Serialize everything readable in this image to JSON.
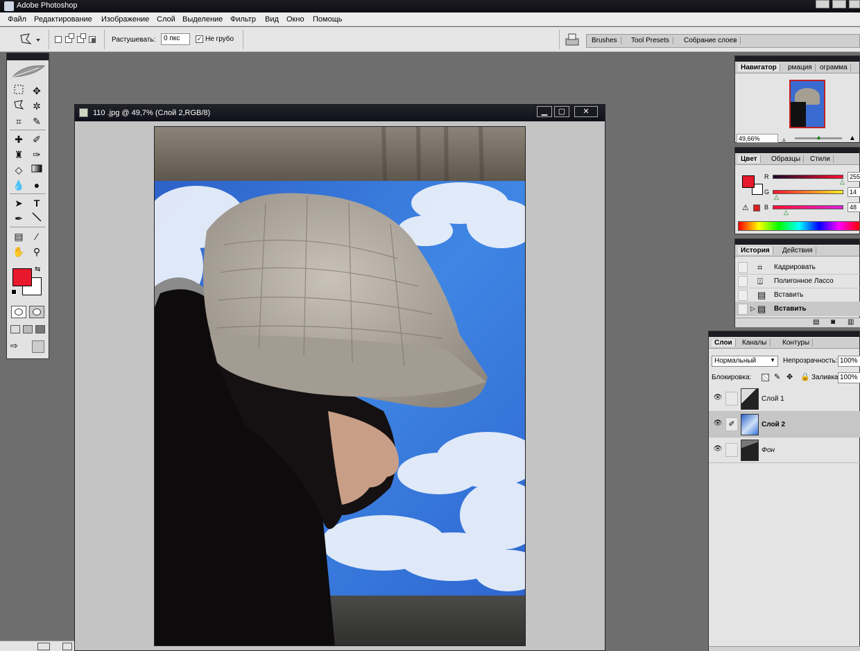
{
  "app": {
    "title": "Adobe Photoshop"
  },
  "menu": [
    "Файл",
    "Редактирование",
    "Изображение",
    "Слой",
    "Выделение",
    "Фильтр",
    "Вид",
    "Окно",
    "Помощь"
  ],
  "options": {
    "feather_label": "Растушевать:",
    "feather_value": "0 пкс",
    "antialias_label": "Не грубо",
    "antialias_check": "✓"
  },
  "palette_well": {
    "tabs": [
      "Brushes",
      "Tool Presets",
      "Собрание слоев"
    ]
  },
  "document": {
    "title": "110 .jpg @ 49,7% (Слой 2,RGB/8)"
  },
  "navigator": {
    "tabs": [
      "Навигатор",
      "рмация",
      "ограмма"
    ],
    "zoom": "49,66%"
  },
  "color": {
    "tabs": [
      "Цвет",
      "Образцы",
      "Стили"
    ],
    "r_label": "R",
    "g_label": "G",
    "b_label": "B",
    "r": "255",
    "g": "14",
    "b": "48",
    "fg_color": "#e8192c",
    "warn_icon": "⚠"
  },
  "history": {
    "tabs": [
      "История",
      "Действия"
    ],
    "items": [
      {
        "label": "Кадрировать",
        "icon": "⌗"
      },
      {
        "label": "Полигонное Лассо",
        "icon": "⍍"
      },
      {
        "label": "Вставить",
        "icon": "▤"
      },
      {
        "label": "Вставить",
        "icon": "▤"
      }
    ]
  },
  "layers": {
    "tabs": [
      "Слои",
      "Каналы",
      "Контуры"
    ],
    "blend_mode": "Нормальный",
    "opacity_label": "Непрозрачность:",
    "opacity": "100%",
    "lock_label": "Блокировка:",
    "fill_label": "Заливка:",
    "fill": "100%",
    "items": [
      {
        "name": "Слой 1",
        "selected": false
      },
      {
        "name": "Слой 2",
        "selected": true
      },
      {
        "name": "Фон",
        "selected": false
      }
    ]
  },
  "tools": {
    "type_glyph": "T"
  }
}
